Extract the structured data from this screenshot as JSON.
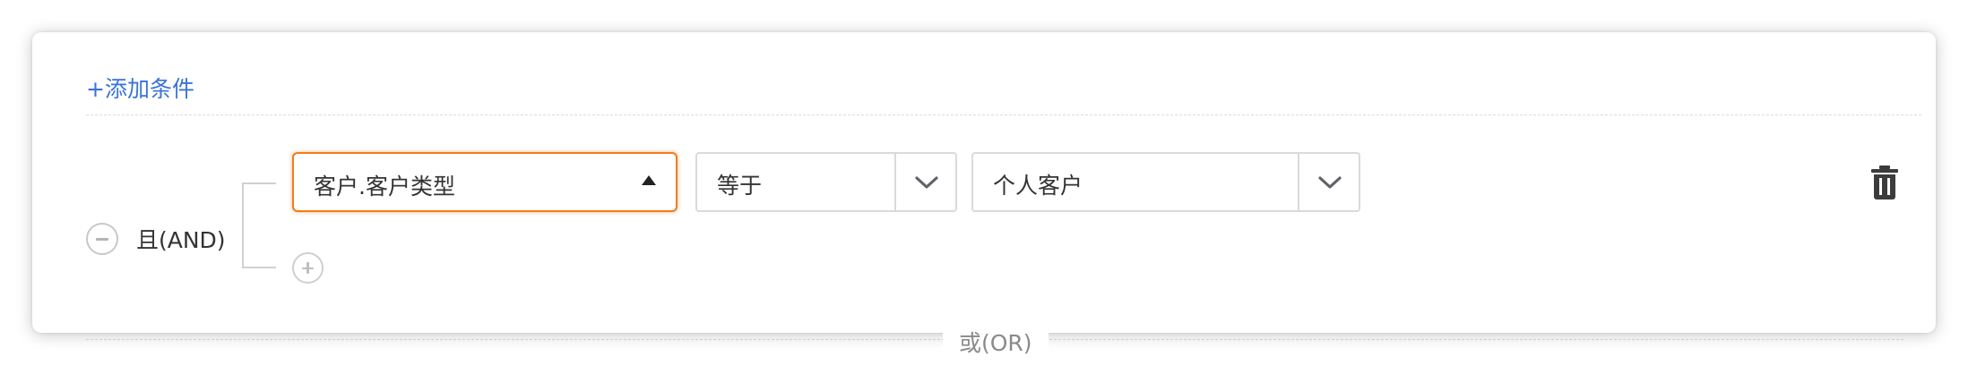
{
  "add_condition_label": "+添加条件",
  "group": {
    "logic_label": "且(AND)"
  },
  "condition": {
    "field_value": "客户.客户类型",
    "operator_value": "等于",
    "value_value": "个人客户"
  },
  "or_label": "或(OR)",
  "colors": {
    "link": "#3a73d8",
    "focus_border": "#f07d1c",
    "border": "#dadada",
    "muted_text": "#8a8a8a"
  },
  "icons": {
    "group_toggle": "minus-circle-icon",
    "add_sub": "plus-circle-icon",
    "field_dropdown": "caret-up-icon",
    "select_dropdown": "chevron-down-icon",
    "delete": "trash-icon"
  }
}
